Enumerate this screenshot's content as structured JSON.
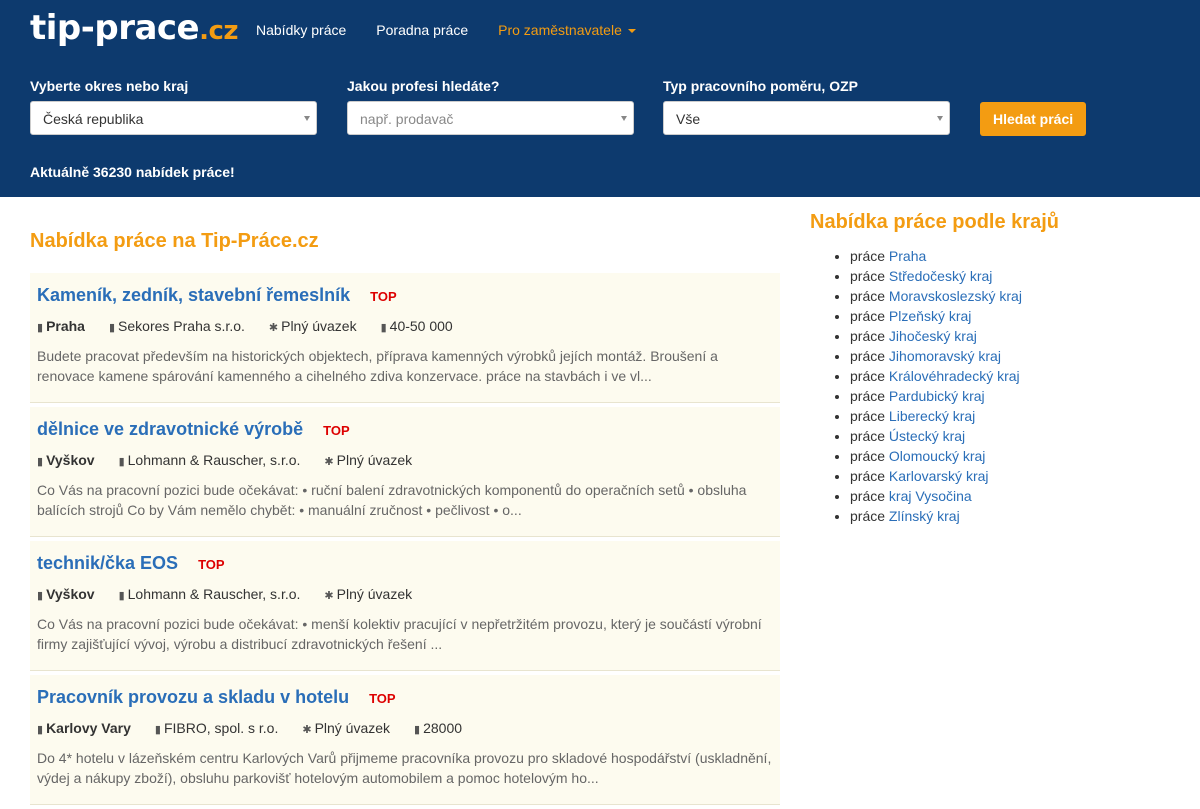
{
  "brand": {
    "name": "tip-prace",
    "tld": ".cz"
  },
  "nav": {
    "items": [
      "Nabídky práce",
      "Poradna práce"
    ],
    "employers": "Pro zaměstnavatele"
  },
  "search": {
    "region_label": "Vyberte okres nebo kraj",
    "region_value": "Česká republika",
    "profession_label": "Jakou profesi hledáte?",
    "profession_placeholder": "např. prodavač",
    "type_label": "Typ pracovního poměru, OZP",
    "type_value": "Vše",
    "button": "Hledat práci"
  },
  "count_text": "Aktuálně 36230 nabídek práce!",
  "main_title": "Nabídka práce na Tip-Práce.cz",
  "jobs": [
    {
      "title": "Kameník, zedník, stavební řemeslník",
      "badge": "TOP",
      "location": "Praha",
      "company": "Sekores Praha s.r.o.",
      "type": "Plný úvazek",
      "salary": "40-50 000",
      "desc": "Budete pracovat především na historických objektech, příprava kamenných výrobků jejích montáž. Broušení a renovace kamene spárování kamenného a cihelného zdiva konzervace. práce na stavbách i ve vl..."
    },
    {
      "title": "dělnice ve zdravotnické výrobě",
      "badge": "TOP",
      "location": "Vyškov",
      "company": "Lohmann & Rauscher, s.r.o.",
      "type": "Plný úvazek",
      "salary": "",
      "desc": "Co Vás na pracovní pozici bude očekávat: • ruční balení zdravotnických komponentů do operačních setů • obsluha balících strojů Co by Vám nemělo chybět: • manuální zručnost • pečlivost • o..."
    },
    {
      "title": "technik/čka EOS",
      "badge": "TOP",
      "location": "Vyškov",
      "company": "Lohmann & Rauscher, s.r.o.",
      "type": "Plný úvazek",
      "salary": "",
      "desc": "Co Vás na pracovní pozici bude očekávat: • menší kolektiv pracující v nepřetržitém provozu, který je součástí výrobní firmy zajišťující vývoj, výrobu a distribucí zdravotnických řešení ..."
    },
    {
      "title": "Pracovník provozu a skladu v hotelu",
      "badge": "TOP",
      "location": "Karlovy Vary",
      "company": "FIBRO, spol. s r.o.",
      "type": "Plný úvazek",
      "salary": "28000",
      "desc": "Do 4* hotelu v lázeňském centru Karlových Varů přijmeme pracovníka provozu pro skladové hospodářství (uskladnění, výdej a nákupy zboží), obsluhu parkovišť hotelovým automobilem a pomoc hotelovým ho..."
    }
  ],
  "side_title": "Nabídka práce podle krajů",
  "side_prefix": "práce",
  "regions": [
    "Praha",
    "Středočeský kraj",
    "Moravskoslezský kraj",
    "Plzeňský kraj",
    "Jihočeský kraj",
    "Jihomoravský kraj",
    "Královéhradecký kraj",
    "Pardubický kraj",
    "Liberecký kraj",
    "Ústecký kraj",
    "Olomoucký kraj",
    "Karlovarský kraj",
    "kraj Vysočina",
    "Zlínský kraj"
  ]
}
